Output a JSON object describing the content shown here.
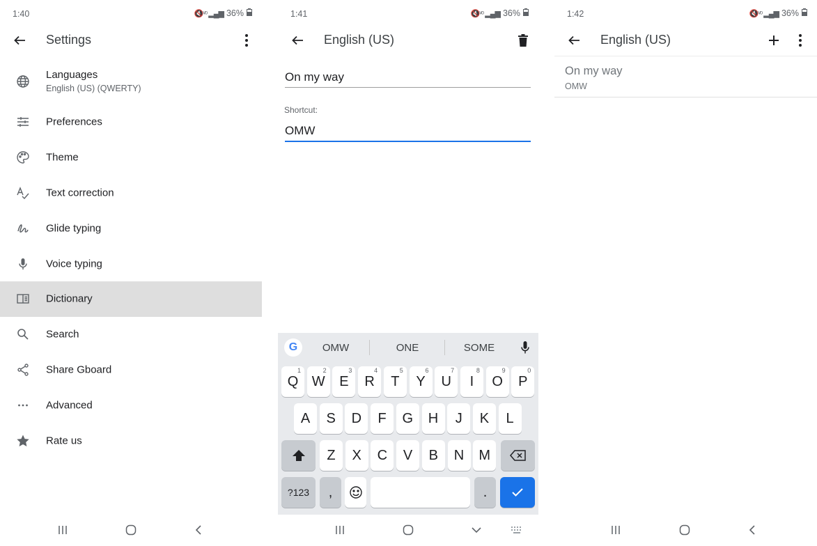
{
  "panel1": {
    "time": "1:40",
    "battery": "36%",
    "title": "Settings",
    "menu": [
      {
        "label": "Languages",
        "sub": "English (US) (QWERTY)",
        "icon": "globe-icon"
      },
      {
        "label": "Preferences",
        "icon": "sliders-icon"
      },
      {
        "label": "Theme",
        "icon": "palette-icon"
      },
      {
        "label": "Text correction",
        "icon": "text-correction-icon"
      },
      {
        "label": "Glide typing",
        "icon": "glide-icon"
      },
      {
        "label": "Voice typing",
        "icon": "mic-icon"
      },
      {
        "label": "Dictionary",
        "icon": "book-icon",
        "selected": true
      },
      {
        "label": "Search",
        "icon": "search-icon"
      },
      {
        "label": "Share Gboard",
        "icon": "share-icon"
      },
      {
        "label": "Advanced",
        "icon": "more-horiz-icon"
      },
      {
        "label": "Rate us",
        "icon": "star-icon"
      }
    ]
  },
  "panel2": {
    "time": "1:41",
    "battery": "36%",
    "title": "English (US)",
    "word_value": "On my way",
    "shortcut_label": "Shortcut:",
    "shortcut_value": "OMW",
    "suggestions": [
      "OMW",
      "ONE",
      "SOME"
    ],
    "keyboard": {
      "row1": [
        "Q",
        "W",
        "E",
        "R",
        "T",
        "Y",
        "U",
        "I",
        "O",
        "P"
      ],
      "row1_nums": [
        "1",
        "2",
        "3",
        "4",
        "5",
        "6",
        "7",
        "8",
        "9",
        "0"
      ],
      "row2": [
        "A",
        "S",
        "D",
        "F",
        "G",
        "H",
        "J",
        "K",
        "L"
      ],
      "row3": [
        "Z",
        "X",
        "C",
        "V",
        "B",
        "N",
        "M"
      ],
      "symbols_key": "?123",
      "comma_key": ",",
      "period_key": "."
    }
  },
  "panel3": {
    "time": "1:42",
    "battery": "36%",
    "title": "English (US)",
    "entry_word": "On my way",
    "entry_shortcut": "OMW"
  },
  "colors": {
    "accent": "#1a73e8",
    "selected_row": "#dedede",
    "keyboard_bg": "#e8eaed"
  }
}
